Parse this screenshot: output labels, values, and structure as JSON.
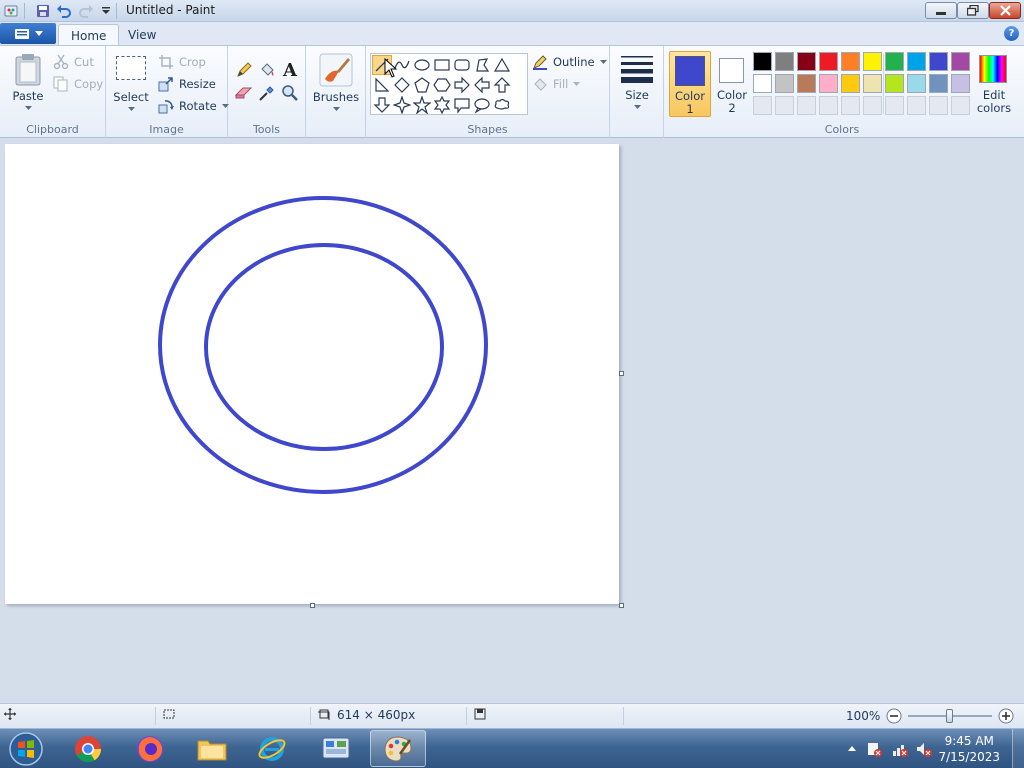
{
  "window": {
    "title": "Untitled - Paint",
    "help_glyph": "?"
  },
  "tabs": [
    {
      "label": "Home"
    },
    {
      "label": "View"
    }
  ],
  "ribbon": {
    "clipboard": {
      "group_label": "Clipboard",
      "paste_label": "Paste",
      "cut_label": "Cut",
      "copy_label": "Copy"
    },
    "image": {
      "group_label": "Image",
      "select_label": "Select",
      "crop_label": "Crop",
      "resize_label": "Resize",
      "rotate_label": "Rotate"
    },
    "tools": {
      "group_label": "Tools",
      "text_tool_glyph": "A"
    },
    "brushes": {
      "label": "Brushes"
    },
    "shapes": {
      "group_label": "Shapes",
      "outline_label": "Outline",
      "fill_label": "Fill"
    },
    "size": {
      "label": "Size"
    },
    "colors": {
      "group_label": "Colors",
      "color1_line1": "Color",
      "color1_line2": "1",
      "color2_line1": "Color",
      "color2_line2": "2",
      "edit_line1": "Edit",
      "edit_line2": "colors",
      "color1_value": "#3f48cc",
      "color2_value": "#ffffff",
      "palette_row1": [
        "#000000",
        "#7f7f7f",
        "#880015",
        "#ed1c24",
        "#ff7f27",
        "#fff200",
        "#22b14c",
        "#00a2e8",
        "#3f48cc",
        "#a349a4"
      ],
      "palette_row2": [
        "#ffffff",
        "#c3c3c3",
        "#b97a57",
        "#ffaec9",
        "#ffc90e",
        "#efe4b0",
        "#b5e61d",
        "#99d9ea",
        "#7092be",
        "#c8bfe7"
      ]
    }
  },
  "canvas": {
    "stroke_color": "#3f48cc",
    "background": "#ffffff"
  },
  "status": {
    "canvas_size": "614 × 460px",
    "zoom": "100%"
  },
  "taskbar": {
    "time": "9:45 AM",
    "date": "7/15/2023"
  }
}
